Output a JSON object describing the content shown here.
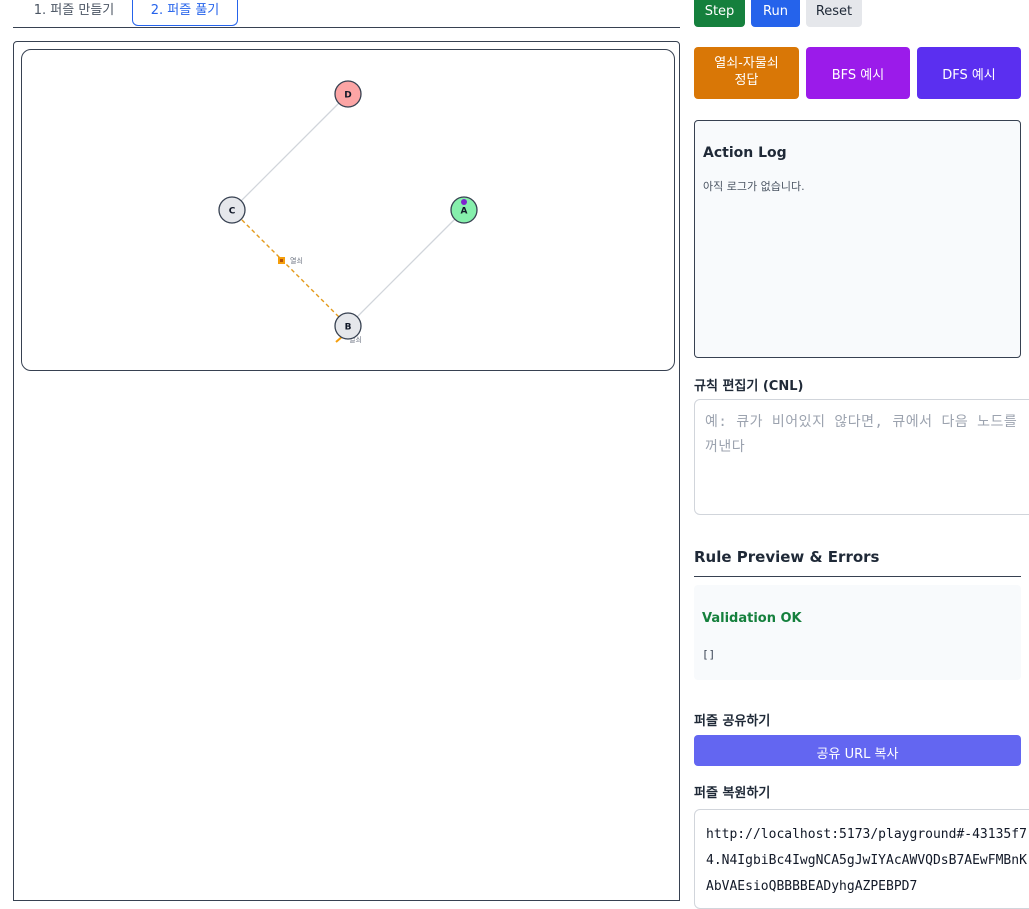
{
  "tabs": [
    "1. 퍼즐 만들기",
    "2. 퍼즐 풀기"
  ],
  "controls": {
    "step": "Step",
    "run": "Run",
    "reset": "Reset"
  },
  "presets": {
    "key": "열쇠-자물쇠 정답",
    "bfs": "BFS 예시",
    "dfs": "DFS 예시"
  },
  "graph": {
    "nodes": [
      "D",
      "C",
      "A",
      "B"
    ],
    "edge_label": "열쇠",
    "node_colors": {
      "D": "#fca5a5",
      "A": "#86efac",
      "C": "#e5e7eb",
      "B": "#e5e7eb"
    },
    "key_edge_color": "#f59e0b"
  },
  "log": {
    "title": "Action Log",
    "empty": "아직 로그가 없습니다."
  },
  "editor": {
    "label": "규칙 편집기 (CNL)",
    "placeholder": "예: 큐가 비어있지 않다면, 큐에서 다음 노드를 꺼낸다"
  },
  "preview": {
    "title": "Rule Preview & Errors",
    "status": "Validation OK",
    "output": "[]"
  },
  "share": {
    "label": "퍼즐 공유하기",
    "button": "공유 URL 복사"
  },
  "restore": {
    "label": "퍼즐 복원하기",
    "value": "http://localhost:5173/playground#-43135f74.N4IgbiBc4IwgNCA5gJwIYAcAWVQDsB7AEwFMBnKAbVAEsioQBBBBEADyhgAZPEBPD7"
  }
}
